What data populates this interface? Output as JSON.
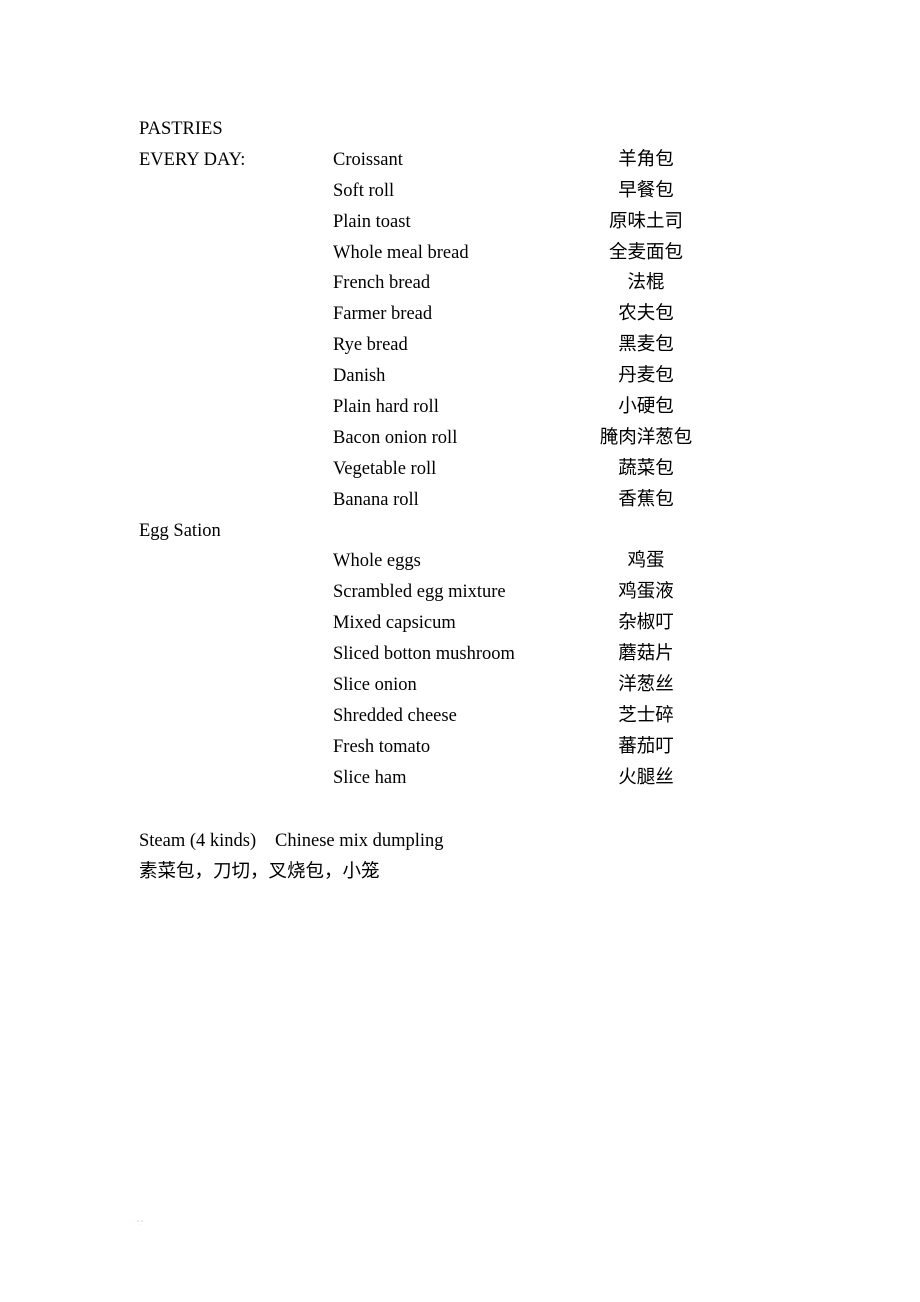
{
  "document": {
    "title": "PASTRIES",
    "page_background": "#ffffff",
    "text_color": "#000000"
  },
  "sections": [
    {
      "id": "pastries",
      "heading": "PASTRIES",
      "subheading": "EVERY DAY:",
      "items": [
        {
          "en": "Croissant",
          "cn": "羊角包"
        },
        {
          "en": "Soft roll",
          "cn": "早餐包"
        },
        {
          "en": "Plain toast",
          "cn": "原味土司"
        },
        {
          "en": "Whole meal bread",
          "cn": "全麦面包"
        },
        {
          "en": "French bread",
          "cn": "法棍"
        },
        {
          "en": "Farmer bread",
          "cn": "农夫包"
        },
        {
          "en": "Rye bread",
          "cn": "黑麦包"
        },
        {
          "en": "Danish",
          "cn": "丹麦包"
        },
        {
          "en": "Plain hard roll",
          "cn": "小硬包"
        },
        {
          "en": "Bacon onion roll",
          "cn": "腌肉洋葱包"
        },
        {
          "en": "Vegetable roll",
          "cn": "蔬菜包"
        },
        {
          "en": "Banana roll",
          "cn": "香蕉包"
        }
      ]
    },
    {
      "id": "egg-station",
      "heading": "Egg Sation",
      "subheading": "",
      "items": [
        {
          "en": "Whole eggs",
          "cn": "鸡蛋"
        },
        {
          "en": "Scrambled egg mixture",
          "cn": "鸡蛋液"
        },
        {
          "en": "Mixed capsicum",
          "cn": "杂椒叮"
        },
        {
          "en": "Sliced botton mushroom",
          "cn": "蘑菇片"
        },
        {
          "en": "Slice onion",
          "cn": "洋葱丝"
        },
        {
          "en": "Shredded cheese",
          "cn": "芝士碎"
        },
        {
          "en": "Fresh tomato",
          "cn": "蕃茄叮"
        },
        {
          "en": "Slice ham",
          "cn": "火腿丝"
        }
      ]
    }
  ],
  "footer": {
    "line1_left": "Steam (4 kinds)",
    "line1_right": "Chinese mix dumpling",
    "line2_cn": "素菜包，刀切，叉烧包，小笼"
  }
}
